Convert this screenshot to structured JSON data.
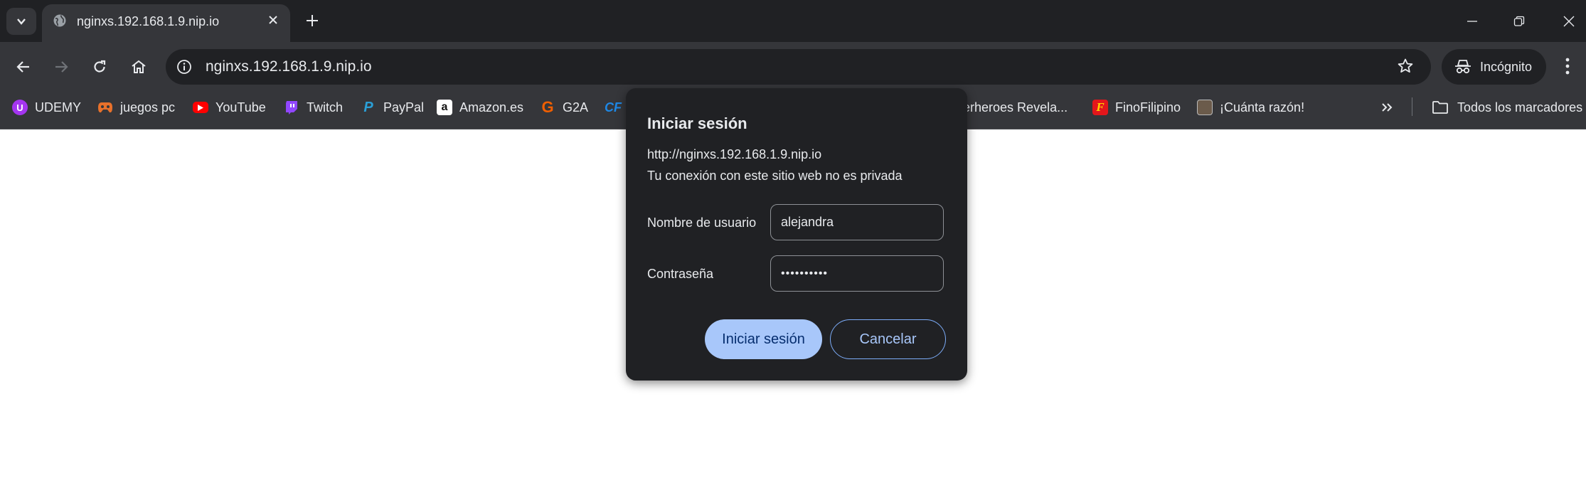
{
  "browser": {
    "tab": {
      "title": "nginxs.192.168.1.9.nip.io",
      "icon": "globe-icon"
    },
    "omnibox": {
      "url": "nginxs.192.168.1.9.nip.io"
    },
    "incognito_label": "Incógnito"
  },
  "bookmarks": [
    {
      "label": "UDEMY",
      "icon": "udemy-icon",
      "color": "#a435f0"
    },
    {
      "label": "juegos pc",
      "icon": "gamepad-icon",
      "color": "#e8712b"
    },
    {
      "label": "YouTube",
      "icon": "youtube-icon",
      "color": "#ff0000"
    },
    {
      "label": "Twitch",
      "icon": "twitch-icon",
      "color": "#9146ff"
    },
    {
      "label": "PayPal",
      "icon": "paypal-icon",
      "color": "#0070ba"
    },
    {
      "label": "Amazon.es",
      "icon": "amazon-icon",
      "color": "#ffffff"
    },
    {
      "label": "G2A",
      "icon": "g2a-icon",
      "color": "#f05f00"
    },
    {
      "label": "CF",
      "icon": "cf-icon",
      "color": "#1e88e5"
    },
    {
      "label": "perheroes Revela...",
      "icon": "",
      "color": ""
    },
    {
      "label": "FinoFilipino",
      "icon": "finofilipino-icon",
      "color": "#e3161b"
    },
    {
      "label": "¡Cuánta razón!",
      "icon": "cuanta-razon-icon",
      "color": "#6b5b4b"
    }
  ],
  "all_bookmarks_label": "Todos los marcadores",
  "dialog": {
    "title": "Iniciar sesión",
    "site": "http://nginxs.192.168.1.9.nip.io",
    "warning": "Tu conexión con este sitio web no es privada",
    "username_label": "Nombre de usuario",
    "username_value": "alejandra",
    "password_label": "Contraseña",
    "password_value": "••••••••••",
    "ok_label": "Iniciar sesión",
    "cancel_label": "Cancelar"
  }
}
